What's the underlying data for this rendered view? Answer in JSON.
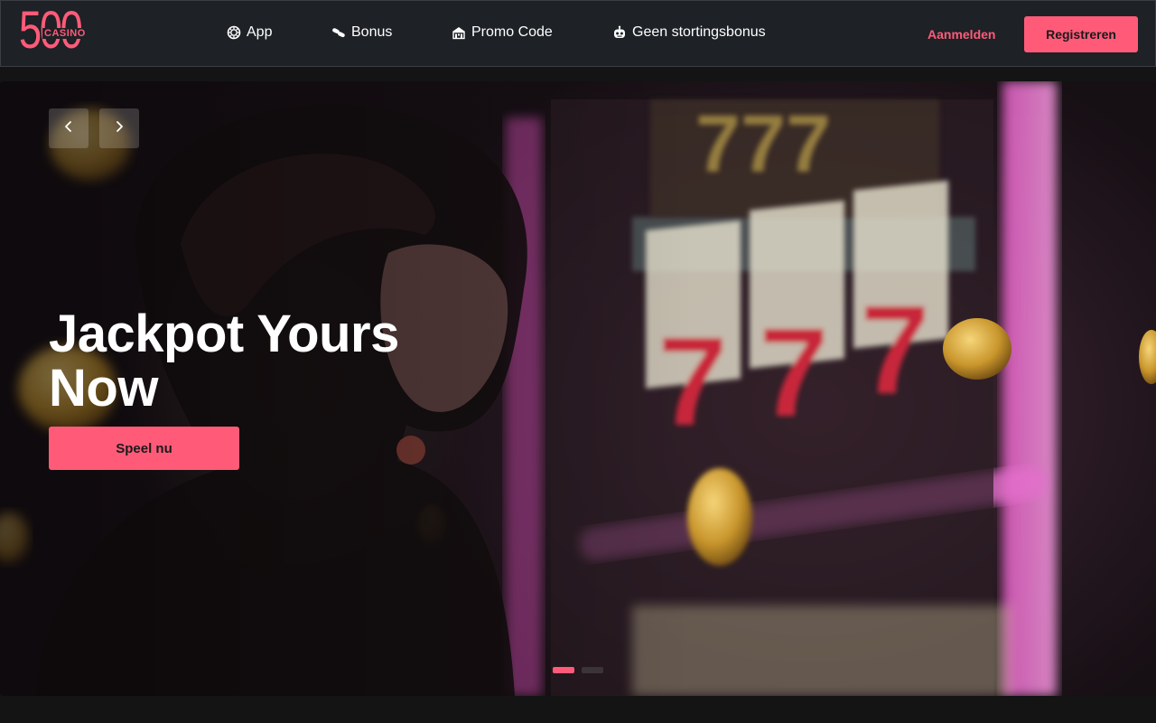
{
  "brand": {
    "logo_digits": "500",
    "logo_word": "CASINO",
    "accent_color": "#ff5b79"
  },
  "nav": {
    "items": [
      {
        "label": "App",
        "icon": "chip-icon"
      },
      {
        "label": "Bonus",
        "icon": "pills-icon"
      },
      {
        "label": "Promo Code",
        "icon": "casino-building-icon"
      },
      {
        "label": "Geen stortingsbonus",
        "icon": "robot-icon"
      }
    ]
  },
  "auth": {
    "login_label": "Aanmelden",
    "register_label": "Registreren"
  },
  "hero": {
    "title": "Jackpot Yours Now",
    "cta_label": "Speel nu",
    "prev_icon": "chevron-left-icon",
    "next_icon": "chevron-right-icon",
    "slide_count": 2,
    "active_slide": 1
  }
}
